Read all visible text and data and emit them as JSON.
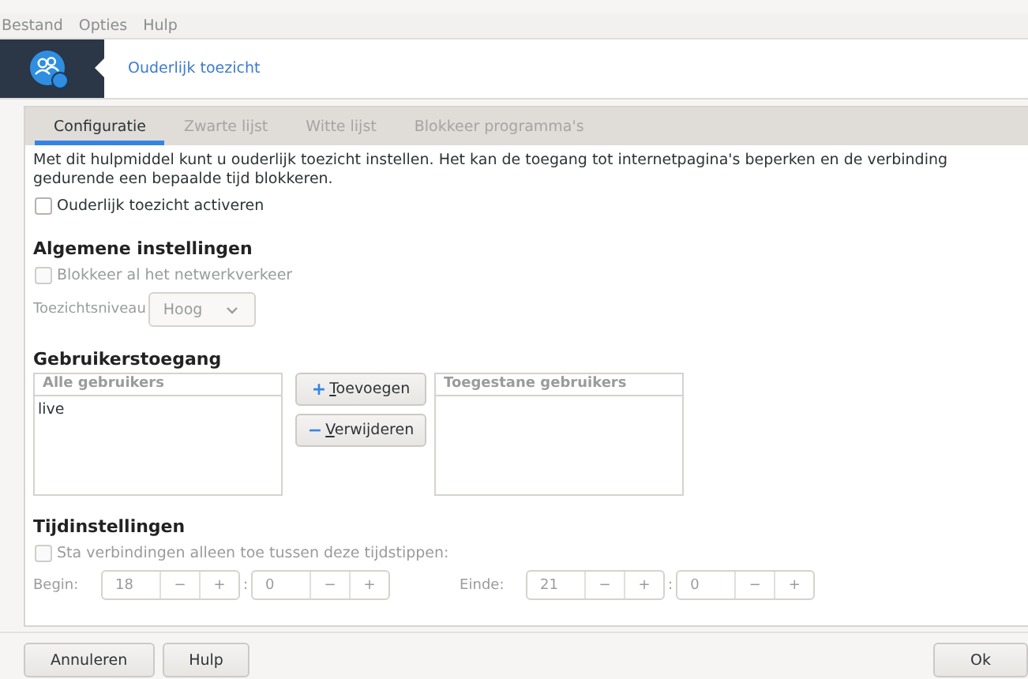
{
  "menu": [
    {
      "label": "Bestand"
    },
    {
      "label": "Opties"
    },
    {
      "label": "Hulp"
    }
  ],
  "header": {
    "title": "Ouderlijk toezicht"
  },
  "tabs": [
    {
      "label": "Configuratie",
      "selected": true
    },
    {
      "label": "Zwarte lijst",
      "selected": false
    },
    {
      "label": "Witte lijst",
      "selected": false
    },
    {
      "label": "Blokkeer programma's",
      "selected": false
    }
  ],
  "intro": "Met dit hulpmiddel kunt u ouderlijk toezicht instellen. Het kan de toegang tot internetpagina's beperken en de verbinding gedurende een bepaalde tijd blokkeren.",
  "activate": {
    "label": "Ouderlijk toezicht activeren",
    "checked": false,
    "disabled": false
  },
  "general": {
    "heading": "Algemene instellingen",
    "block_all": {
      "label": "Blokkeer al het netwerkverkeer",
      "checked": false,
      "disabled": true
    },
    "level_label": "Toezichtsniveau",
    "level_value": "Hoog",
    "disabled": true
  },
  "users": {
    "heading": "Gebruikerstoegang",
    "all_column": "Alle gebruikers",
    "all_items": [
      "live"
    ],
    "add_button": {
      "icon": "+",
      "label": "Toevoegen"
    },
    "remove_button": {
      "icon": "−",
      "label": "Verwijderen"
    },
    "allowed_column": "Toegestane gebruikers"
  },
  "time": {
    "heading": "Tijdinstellingen",
    "restrict": {
      "label": "Sta verbindingen alleen toe tussen deze tijdstippen:",
      "checked": false,
      "disabled": true
    },
    "disabled": true,
    "minus": "−",
    "plus": "+",
    "separator": ":",
    "start": {
      "label": "Begin:",
      "hour": "18",
      "minute": "0"
    },
    "end": {
      "label": "Einde:",
      "hour": "21",
      "minute": "0"
    }
  },
  "footer": {
    "left": [
      "Annuleren",
      "Hulp"
    ],
    "right": [
      "Ok"
    ]
  }
}
